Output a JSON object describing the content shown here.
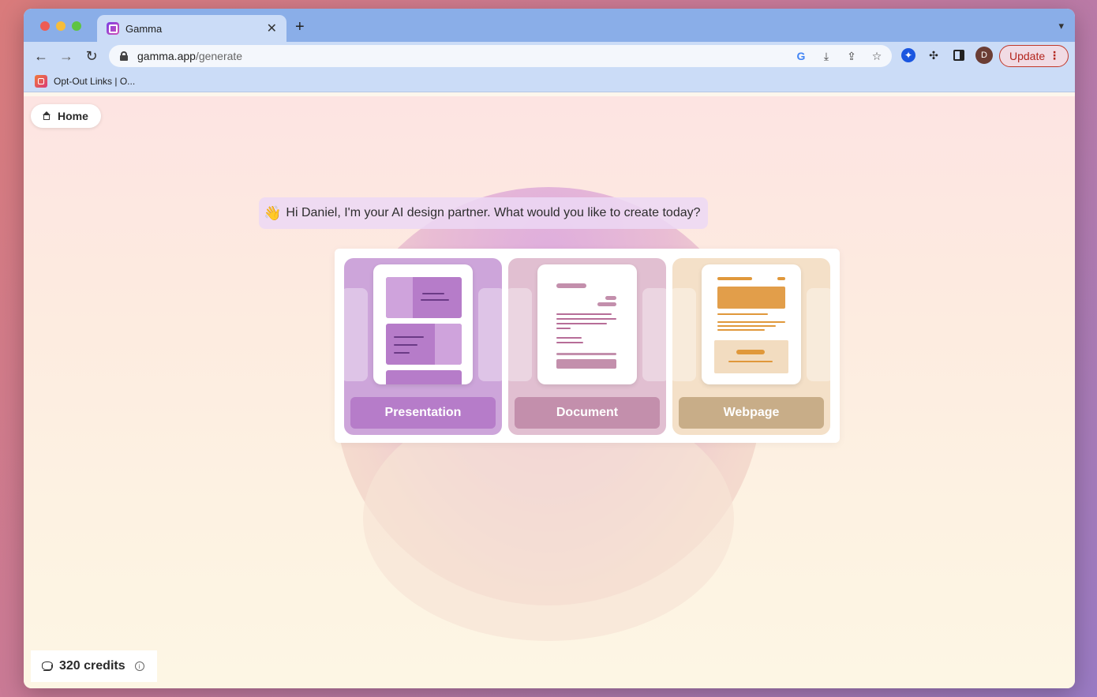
{
  "browser": {
    "tab_title": "Gamma",
    "url_host": "gamma.app",
    "url_path": "/generate",
    "update_label": "Update",
    "profile_initial": "D",
    "bookmark_label": "Opt-Out Links | O..."
  },
  "page": {
    "home_label": "Home",
    "greeting_emoji": "👋",
    "greeting": "Hi Daniel, I'm your AI design partner. What would you like to create today?",
    "cards": [
      {
        "label": "Presentation",
        "color": "#b67cc9"
      },
      {
        "label": "Document",
        "color": "#c38fac"
      },
      {
        "label": "Webpage",
        "color": "#c8ad88"
      }
    ],
    "credits_label": "320 credits"
  }
}
